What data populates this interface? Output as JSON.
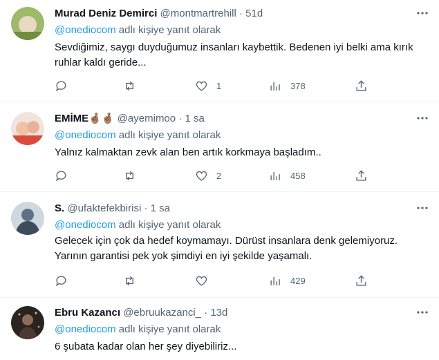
{
  "tweets": [
    {
      "name": "Murad Deniz Demirci",
      "name_suffix": "",
      "handle": "@montmartrehill",
      "separator": "·",
      "time": "51d",
      "mention": "@onediocom",
      "reply_suffix": " adlı kişiye yanıt olarak",
      "text": "Sevdiğimiz, saygı duyduğumuz insanları kaybettik. Bedenen iyi belki ama kırık ruhlar kaldı geride...",
      "likes": "1",
      "views": "378",
      "avatar_colors": [
        "#9fb86a",
        "#e9d9c0"
      ]
    },
    {
      "name": "EMİME",
      "name_suffix": "🤞🏽🤞🏽",
      "handle": "@ayemimoo",
      "separator": "·",
      "time": "1 sa",
      "mention": "@onediocom",
      "reply_suffix": " adlı kişiye yanıt olarak",
      "text": "Yalnız kalmaktan zevk alan ben artık korkmaya başladım..",
      "likes": "2",
      "views": "458",
      "avatar_colors": [
        "#d94a3a",
        "#f2c2a8"
      ]
    },
    {
      "name": "S.",
      "name_suffix": "",
      "handle": "@ufaktefekbirisi",
      "separator": "·",
      "time": "1 sa",
      "mention": "@onediocom",
      "reply_suffix": " adlı kişiye yanıt olarak",
      "text": "Gelecek için çok da hedef koymamayı. Dürüst insanlara denk gelemiyoruz. Yarının garantisi pek yok şimdiyi en iyi şekilde yaşamalı.",
      "likes": "",
      "views": "429",
      "avatar_colors": [
        "#5f7186",
        "#cfd7df"
      ]
    },
    {
      "name": "Ebru Kazancı",
      "name_suffix": "",
      "handle": "@ebruukazanci_",
      "separator": "·",
      "time": "13d",
      "mention": "@onediocom",
      "reply_suffix": " adlı kişiye yanıt olarak",
      "text": "6 şubata kadar olan her şey diyebiliriz...",
      "likes": "",
      "views": "",
      "avatar_colors": [
        "#2b2320",
        "#8a6d5c"
      ]
    }
  ],
  "icons": {
    "more": "more-icon",
    "reply": "reply-icon",
    "retweet": "retweet-icon",
    "like": "heart-icon",
    "views": "views-icon",
    "share": "share-icon"
  },
  "colors": {
    "link": "#1d9bf0",
    "muted": "#536471",
    "text": "#0f1419",
    "divider": "#eff3f4"
  }
}
